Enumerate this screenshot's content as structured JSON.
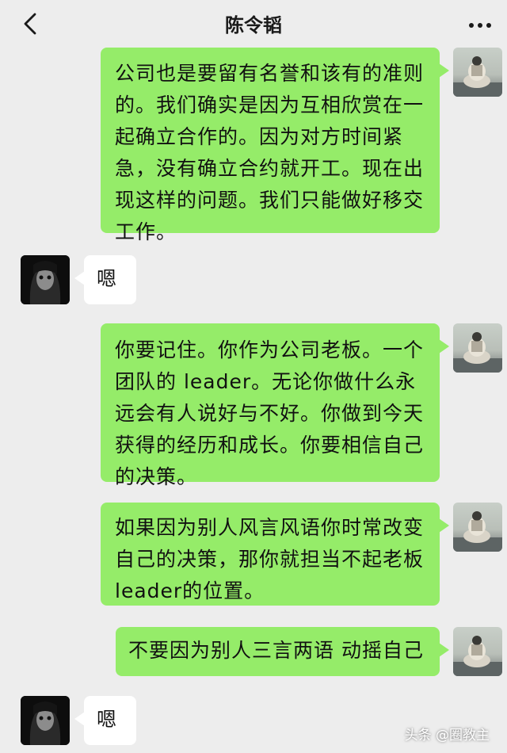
{
  "header": {
    "title": "陈令韬",
    "back_icon": "chevron-left-icon",
    "more_icon": "more-icon"
  },
  "messages": [
    {
      "sender": "me",
      "text": "公司也是要留有名誉和该有的准则的。我们确实是因为互相欣赏在一起确立合作的。因为对方时间紧急，没有确立合约就开工。现在出现这样的问题。我们只能做好移交工作。"
    },
    {
      "sender": "other",
      "text": "嗯"
    },
    {
      "sender": "me",
      "text": "你要记住。你作为公司老板。一个团队的 leader。无论你做什么永远会有人说好与不好。你做到今天获得的经历和成长。你要相信自己的决策。"
    },
    {
      "sender": "me",
      "text": "如果因为别人风言风语你时常改变自己的决策，那你就担当不起老板 leader的位置。"
    },
    {
      "sender": "me",
      "text": "不要因为别人三言两语 动摇自己"
    },
    {
      "sender": "other",
      "text": "嗯"
    }
  ],
  "watermark": "头条 @圈教主",
  "colors": {
    "background": "#ededed",
    "my_bubble": "#95ec69",
    "their_bubble": "#ffffff"
  }
}
